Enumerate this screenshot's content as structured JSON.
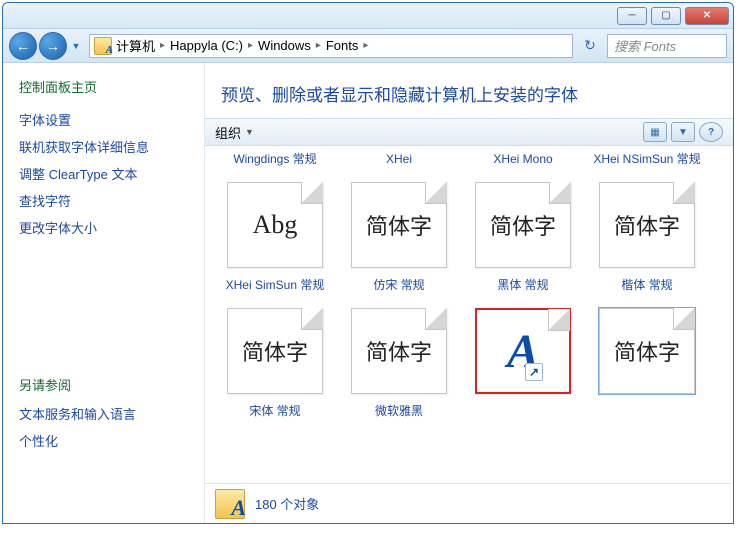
{
  "titlebar": {
    "min": "─",
    "max": "▢",
    "close": "✕"
  },
  "nav": {
    "back": "←",
    "forward": "→",
    "dropdown": "▼"
  },
  "breadcrumb": {
    "items": [
      "计算机",
      "Happyla (C:)",
      "Windows",
      "Fonts"
    ],
    "sep": "▸"
  },
  "refresh_glyph": "↻",
  "search": {
    "placeholder": "搜索 Fonts"
  },
  "sidebar": {
    "title": "控制面板主页",
    "links": [
      "字体设置",
      "联机获取字体详细信息",
      "调整 ClearType 文本",
      "查找字符",
      "更改字体大小"
    ],
    "see_also_title": "另请参阅",
    "see_also_links": [
      "文本服务和输入语言",
      "个性化"
    ]
  },
  "main": {
    "heading": "预览、删除或者显示和隐藏计算机上安装的字体",
    "toolbar": {
      "organize": "组织",
      "dropdown": "▼",
      "view_glyph": "▦",
      "help_glyph": "?"
    }
  },
  "fonts_row1": [
    {
      "label": "Wingdings 常规",
      "sample": "Abg",
      "klass": "abg",
      "stack": false
    },
    {
      "label": "XHei",
      "sample": "简体字",
      "klass": "",
      "stack": true
    },
    {
      "label": "XHei Mono",
      "sample": "简体字",
      "klass": "",
      "stack": false
    },
    {
      "label": "XHei NSimSun 常规",
      "sample": "简体字",
      "klass": "",
      "stack": false
    }
  ],
  "fonts_row2": [
    {
      "label": "XHei SimSun 常规",
      "sample": "简体字",
      "klass": "",
      "stack": false,
      "highlight": false,
      "outlined": false,
      "special": ""
    },
    {
      "label": "仿宋 常规",
      "sample": "简体字",
      "klass": "",
      "stack": true,
      "highlight": false,
      "outlined": false,
      "special": ""
    },
    {
      "label": "黑体 常规",
      "sample": "A",
      "klass": "",
      "stack": false,
      "highlight": true,
      "outlined": false,
      "special": "shortcut"
    },
    {
      "label": "楷体 常规",
      "sample": "简体字",
      "klass": "",
      "stack": false,
      "highlight": false,
      "outlined": true,
      "special": ""
    }
  ],
  "fonts_row3": [
    {
      "label": "宋体 常规"
    },
    {
      "label": "微软雅黑"
    }
  ],
  "status": {
    "count_text": "180 个对象"
  }
}
